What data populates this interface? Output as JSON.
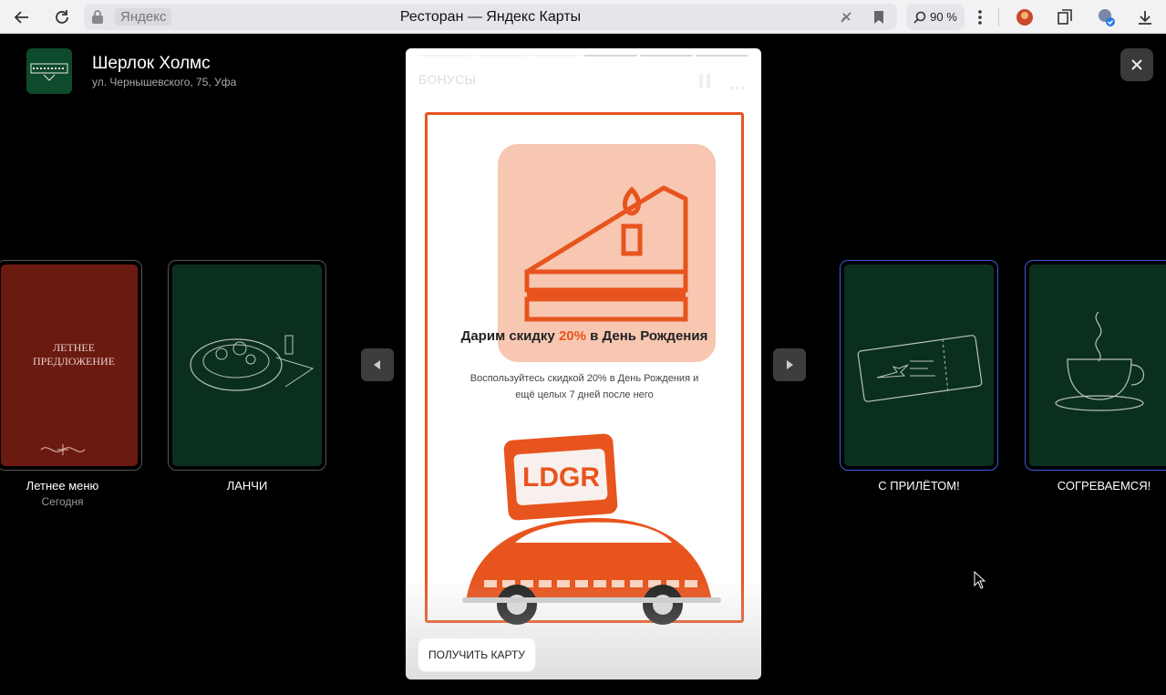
{
  "browser": {
    "domain": "Яндекс",
    "tab_title": "Ресторан — Яндекс Карты",
    "zoom": "90 %"
  },
  "place": {
    "name": "Шерлок Холмс",
    "address": "ул. Чернышевского, 75, Уфа"
  },
  "stories_left": [
    {
      "label": "Летнее меню",
      "sub": "Сегодня",
      "card_text": "ЛЕТНЕЕ ПРЕДЛОЖЕНИЕ",
      "bg": "#6b1a12"
    },
    {
      "label": "ЛАНЧИ",
      "bg": "#0b2f1e"
    }
  ],
  "stories_right": [
    {
      "label": "С ПРИЛЁТОМ!",
      "bg": "#0b2f1e"
    },
    {
      "label": "СОГРЕВАЕМСЯ!",
      "bg": "#0b2f1e"
    }
  ],
  "story": {
    "title": "БОНУСЫ",
    "progress_segments": 6,
    "progress_done": 3,
    "headline_before": "Дарим скидку ",
    "headline_accent": "20%",
    "headline_after": " в День Рождения",
    "subtext": "Воспользуйтесь скидкой 20% в День Рождения и ещё целых 7 дней после него",
    "cta": "ПОЛУЧИТЬ КАРТУ",
    "accent_color": "#e8541e"
  }
}
